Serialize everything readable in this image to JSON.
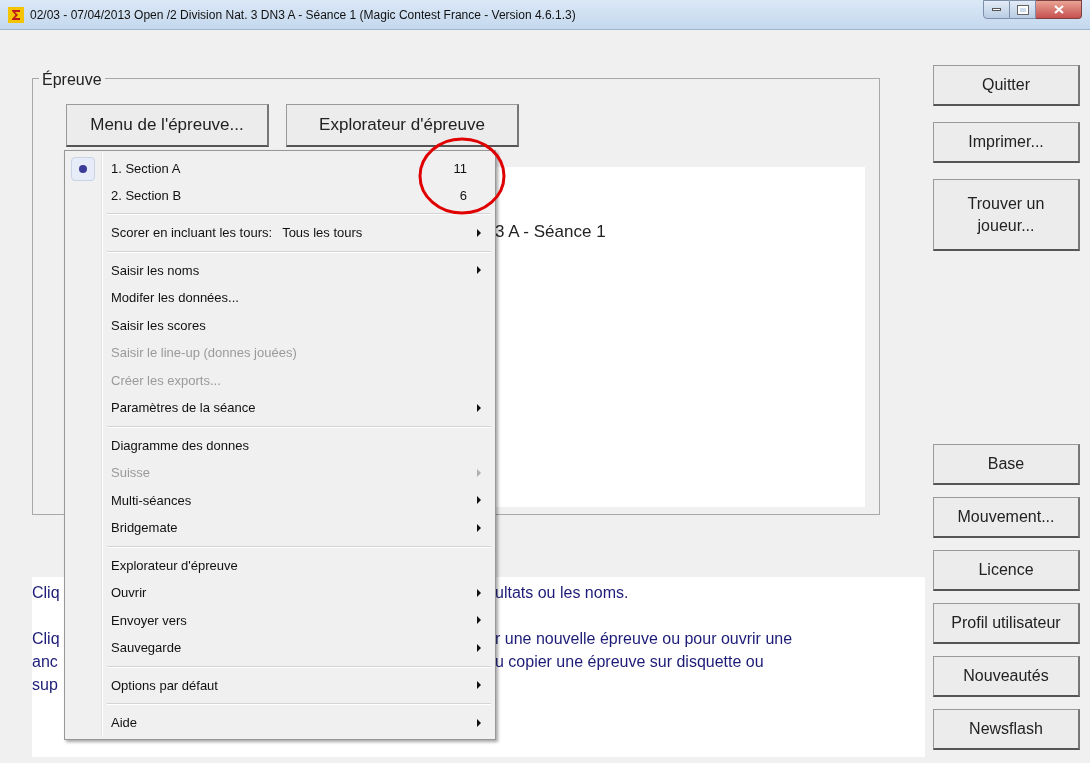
{
  "window": {
    "title": "02/03 - 07/04/2013  Open /2 Division Nat. 3 DN3 A - Séance 1  (Magic Contest France - Version 4.6.1.3)"
  },
  "group": {
    "legend": "Épreuve",
    "buttons": [
      "Menu de l'épreuve...",
      "Explorateur d'épreuve"
    ],
    "panel_text": "3 A - Séance 1"
  },
  "menu": [
    {
      "kind": "section",
      "label": "1. Section A",
      "count": "11",
      "selected": true
    },
    {
      "kind": "section",
      "label": "2. Section B",
      "count": "6",
      "selected": false
    },
    {
      "kind": "separator"
    },
    {
      "kind": "item",
      "label": "Scorer en incluant les tours:",
      "value": "Tous les tours",
      "disabled": false,
      "submenu": true
    },
    {
      "kind": "separator"
    },
    {
      "kind": "item",
      "label": "Saisir les noms",
      "disabled": false,
      "submenu": true
    },
    {
      "kind": "item",
      "label": "Modifer les données...",
      "disabled": false,
      "submenu": false
    },
    {
      "kind": "item",
      "label": "Saisir les scores",
      "disabled": false,
      "submenu": false
    },
    {
      "kind": "item",
      "label": "Saisir le line-up (donnes jouées)",
      "disabled": true,
      "submenu": false
    },
    {
      "kind": "item",
      "label": "Créer les exports...",
      "disabled": true,
      "submenu": false
    },
    {
      "kind": "item",
      "label": "Paramètres de la séance",
      "disabled": false,
      "submenu": true
    },
    {
      "kind": "separator"
    },
    {
      "kind": "item",
      "label": "Diagramme des donnes",
      "disabled": false,
      "submenu": false
    },
    {
      "kind": "item",
      "label": "Suisse",
      "disabled": true,
      "submenu": true
    },
    {
      "kind": "item",
      "label": "Multi-séances",
      "disabled": false,
      "submenu": true
    },
    {
      "kind": "item",
      "label": "Bridgemate",
      "disabled": false,
      "submenu": true
    },
    {
      "kind": "separator"
    },
    {
      "kind": "item",
      "label": "Explorateur d'épreuve",
      "disabled": false,
      "submenu": false
    },
    {
      "kind": "item",
      "label": "Ouvrir",
      "disabled": false,
      "submenu": true
    },
    {
      "kind": "item",
      "label": "Envoyer vers",
      "disabled": false,
      "submenu": true
    },
    {
      "kind": "item",
      "label": "Sauvegarde",
      "disabled": false,
      "submenu": true
    },
    {
      "kind": "separator"
    },
    {
      "kind": "item",
      "label": "Options par défaut",
      "disabled": false,
      "submenu": true
    },
    {
      "kind": "separator"
    },
    {
      "kind": "item",
      "label": "Aide",
      "disabled": false,
      "submenu": true
    }
  ],
  "info": {
    "left_paragraphs": [
      [
        "Cliq"
      ],
      [
        "Cliq",
        "anc",
        "sup"
      ]
    ],
    "right_paragraphs": [
      [
        "ultats ou les noms."
      ],
      [
        "r une nouvelle épreuve ou pour ouvrir une",
        "u copier une épreuve sur disquette ou"
      ]
    ]
  },
  "side_buttons_top": [
    "Quitter",
    "Imprimer...",
    "Trouver un joueur..."
  ],
  "side_buttons_bottom": [
    "Base",
    "Mouvement...",
    "Licence",
    "Profil utilisateur",
    "Nouveautés",
    "Newsflash"
  ]
}
